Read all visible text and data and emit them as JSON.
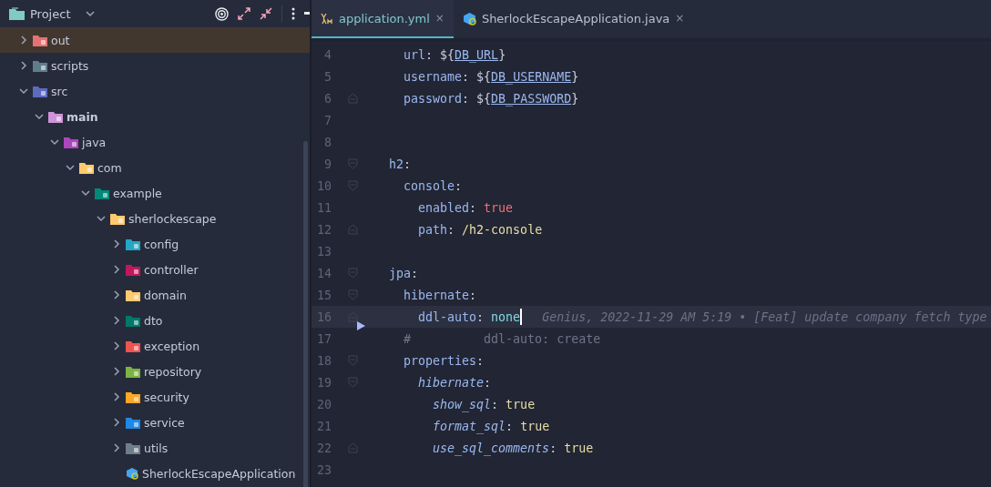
{
  "project_panel": {
    "title": "Project",
    "tree": [
      {
        "label": "out",
        "kind": "folder",
        "color": "#e57373",
        "expanded": false,
        "selected": true
      },
      {
        "label": "scripts",
        "kind": "folder",
        "color": "#607d8b",
        "expanded": false,
        "selected": false
      },
      {
        "label": "src",
        "kind": "folder",
        "color": "#5c6bc0",
        "expanded": true,
        "selected": false,
        "children": [
          {
            "label": "main",
            "kind": "folder",
            "color": "#ce93d8",
            "expanded": true,
            "selected": false,
            "bold": true,
            "children": [
              {
                "label": "java",
                "kind": "folder",
                "color": "#ab47bc",
                "expanded": true,
                "selected": false,
                "children": [
                  {
                    "label": "com",
                    "kind": "folder",
                    "color": "#ffca6e",
                    "expanded": true,
                    "selected": false,
                    "children": [
                      {
                        "label": "example",
                        "kind": "folder",
                        "color": "#00897b",
                        "expanded": true,
                        "selected": false,
                        "children": [
                          {
                            "label": "sherlockescape",
                            "kind": "folder",
                            "color": "#ffca6e",
                            "expanded": true,
                            "selected": false,
                            "children": [
                              {
                                "label": "config",
                                "kind": "folder",
                                "color": "#26a6c4",
                                "expanded": false,
                                "selected": false
                              },
                              {
                                "label": "controller",
                                "kind": "folder",
                                "color": "#c2185b",
                                "expanded": false,
                                "selected": false
                              },
                              {
                                "label": "domain",
                                "kind": "folder",
                                "color": "#ffca6e",
                                "expanded": false,
                                "selected": false
                              },
                              {
                                "label": "dto",
                                "kind": "folder",
                                "color": "#00796b",
                                "expanded": false,
                                "selected": false
                              },
                              {
                                "label": "exception",
                                "kind": "folder",
                                "color": "#ef5350",
                                "expanded": false,
                                "selected": false
                              },
                              {
                                "label": "repository",
                                "kind": "folder",
                                "color": "#7cb342",
                                "expanded": false,
                                "selected": false
                              },
                              {
                                "label": "security",
                                "kind": "folder",
                                "color": "#ffa726",
                                "expanded": false,
                                "selected": false
                              },
                              {
                                "label": "service",
                                "kind": "folder",
                                "color": "#1e88e5",
                                "expanded": false,
                                "selected": false
                              },
                              {
                                "label": "utils",
                                "kind": "folder",
                                "color": "#6e7e8a",
                                "expanded": false,
                                "selected": false
                              },
                              {
                                "label": "SherlockEscapeApplication",
                                "kind": "file",
                                "color": "#42a5f5",
                                "selected": false
                              }
                            ]
                          }
                        ]
                      }
                    ]
                  }
                ]
              }
            ]
          }
        ]
      }
    ]
  },
  "tabs": [
    {
      "label": "application.yml",
      "kind": "yaml",
      "close": "×",
      "selected": true
    },
    {
      "label": "SherlockEscapeApplication.java",
      "kind": "java",
      "close": "×",
      "selected": false
    }
  ],
  "editor": {
    "lines": [
      {
        "number": "4",
        "fold_start": false,
        "fold_end": false,
        "current": false,
        "tokens": [
          {
            "kind": "key",
            "text": "    url"
          },
          {
            "kind": "punct",
            "text": ": ${"
          },
          {
            "kind": "ref",
            "text": "DB_URL"
          },
          {
            "kind": "punct",
            "text": "}"
          }
        ]
      },
      {
        "number": "5",
        "fold_start": false,
        "fold_end": false,
        "current": false,
        "tokens": [
          {
            "kind": "key",
            "text": "    username"
          },
          {
            "kind": "punct",
            "text": ": ${"
          },
          {
            "kind": "ref",
            "text": "DB_USERNAME"
          },
          {
            "kind": "punct",
            "text": "}"
          }
        ]
      },
      {
        "number": "6",
        "fold_start": false,
        "fold_end": true,
        "current": false,
        "tokens": [
          {
            "kind": "key",
            "text": "    password"
          },
          {
            "kind": "punct",
            "text": ": ${"
          },
          {
            "kind": "ref",
            "text": "DB_PASSWORD"
          },
          {
            "kind": "punct",
            "text": "}"
          }
        ]
      },
      {
        "number": "7",
        "fold_start": false,
        "fold_end": false,
        "current": false
      },
      {
        "number": "8",
        "fold_start": false,
        "fold_end": false,
        "current": false
      },
      {
        "number": "9",
        "fold_start": true,
        "fold_end": false,
        "current": false,
        "tokens": [
          {
            "kind": "key",
            "text": "  h2"
          },
          {
            "kind": "punct",
            "text": ":"
          }
        ]
      },
      {
        "number": "10",
        "fold_start": true,
        "fold_end": false,
        "current": false,
        "tokens": [
          {
            "kind": "key",
            "text": "    console"
          },
          {
            "kind": "punct",
            "text": ":"
          }
        ]
      },
      {
        "number": "11",
        "fold_start": false,
        "fold_end": false,
        "current": false,
        "tokens": [
          {
            "kind": "key",
            "text": "      enabled"
          },
          {
            "kind": "punct",
            "text": ": "
          },
          {
            "kind": "boolean",
            "text": "true"
          }
        ]
      },
      {
        "number": "12",
        "fold_start": false,
        "fold_end": true,
        "current": false,
        "tokens": [
          {
            "kind": "key",
            "text": "      path"
          },
          {
            "kind": "punct",
            "text": ": "
          },
          {
            "kind": "scalar",
            "text": "/h2-console"
          }
        ]
      },
      {
        "number": "13",
        "fold_start": false,
        "fold_end": false,
        "current": false
      },
      {
        "number": "14",
        "fold_start": true,
        "fold_end": false,
        "current": false,
        "tokens": [
          {
            "kind": "key",
            "text": "  jpa"
          },
          {
            "kind": "punct",
            "text": ":"
          }
        ]
      },
      {
        "number": "15",
        "fold_start": true,
        "fold_end": false,
        "current": false,
        "tokens": [
          {
            "kind": "key",
            "text": "    hibernate"
          },
          {
            "kind": "punct",
            "text": ":"
          }
        ]
      },
      {
        "number": "16",
        "fold_start": false,
        "fold_end": true,
        "current": true,
        "caret": true,
        "annotation": "Genius, 2022-11-29 AM 5:19 • [Feat] update company fetch type",
        "tokens": [
          {
            "kind": "key",
            "text": "      ddl-auto"
          },
          {
            "kind": "punct",
            "text": ": "
          },
          {
            "kind": "enum",
            "text": "none"
          }
        ]
      },
      {
        "number": "17",
        "fold_start": false,
        "fold_end": false,
        "current": false,
        "tokens": [
          {
            "kind": "comment",
            "text": "    #          ddl-auto: create"
          }
        ]
      },
      {
        "number": "18",
        "fold_start": true,
        "fold_end": false,
        "current": false,
        "tokens": [
          {
            "kind": "key",
            "text": "    properties"
          },
          {
            "kind": "punct",
            "text": ":"
          }
        ]
      },
      {
        "number": "19",
        "fold_start": true,
        "fold_end": false,
        "current": false,
        "tokens": [
          {
            "kind": "italic-key",
            "text": "      hibernate"
          },
          {
            "kind": "punct",
            "text": ":"
          }
        ]
      },
      {
        "number": "20",
        "fold_start": false,
        "fold_end": false,
        "current": false,
        "tokens": [
          {
            "kind": "italic-key",
            "text": "        show_sql"
          },
          {
            "kind": "punct",
            "text": ": "
          },
          {
            "kind": "scalar",
            "text": "true"
          }
        ]
      },
      {
        "number": "21",
        "fold_start": false,
        "fold_end": false,
        "current": false,
        "tokens": [
          {
            "kind": "italic-key",
            "text": "        format_sql"
          },
          {
            "kind": "punct",
            "text": ": "
          },
          {
            "kind": "scalar",
            "text": "true"
          }
        ]
      },
      {
        "number": "22",
        "fold_start": false,
        "fold_end": true,
        "current": false,
        "tokens": [
          {
            "kind": "italic-key",
            "text": "        use_sql_comments"
          },
          {
            "kind": "punct",
            "text": ": "
          },
          {
            "kind": "scalar",
            "text": "true"
          }
        ]
      },
      {
        "number": "23",
        "fold_start": false,
        "fold_end": false,
        "current": false
      }
    ]
  }
}
